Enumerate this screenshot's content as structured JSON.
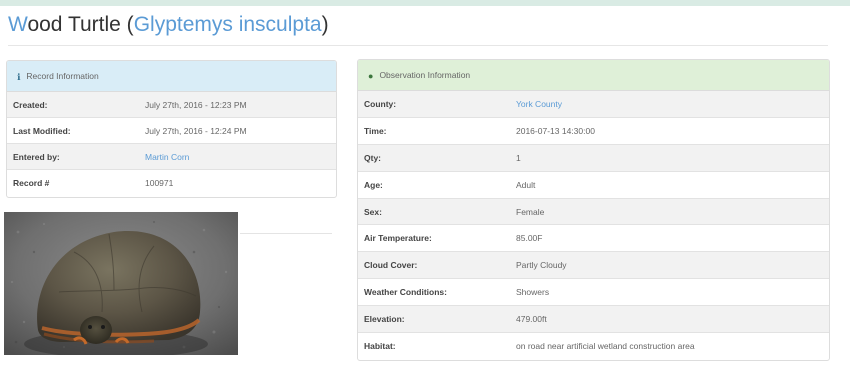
{
  "title": {
    "first_letter": "W",
    "common_rest": "ood Turtle (",
    "species": "Glyptemys insculpta",
    "close": ")"
  },
  "record_panel": {
    "heading": "Record Information",
    "icon": "info-icon",
    "accent": "#d9edf7",
    "rows": [
      {
        "label": "Created:",
        "value": "July 27th, 2016 - 12:23 PM"
      },
      {
        "label": "Last Modified:",
        "value": "July 27th, 2016 - 12:24 PM"
      },
      {
        "label": "Entered by:",
        "value": "Martin Corn"
      },
      {
        "label": "Record #",
        "value": "100971"
      }
    ]
  },
  "observation_panel": {
    "heading": "Observation Information",
    "icon": "eye-icon",
    "accent": "#dff0d8",
    "rows": [
      {
        "label": "County:",
        "value": "York County"
      },
      {
        "label": "Time:",
        "value": "2016-07-13 14:30:00"
      },
      {
        "label": "Qty:",
        "value": "1"
      },
      {
        "label": "Age:",
        "value": "Adult"
      },
      {
        "label": "Sex:",
        "value": "Female"
      },
      {
        "label": "Air Temperature:",
        "value": "85.00F"
      },
      {
        "label": "Cloud Cover:",
        "value": "Partly Cloudy"
      },
      {
        "label": "Weather Conditions:",
        "value": "Showers"
      },
      {
        "label": "Elevation:",
        "value": "479.00ft"
      },
      {
        "label": "Habitat:",
        "value": "on road near artificial wetland construction area"
      }
    ]
  },
  "colors": {
    "link": "#5b9bd5",
    "stripe": "#f2f2f2"
  }
}
